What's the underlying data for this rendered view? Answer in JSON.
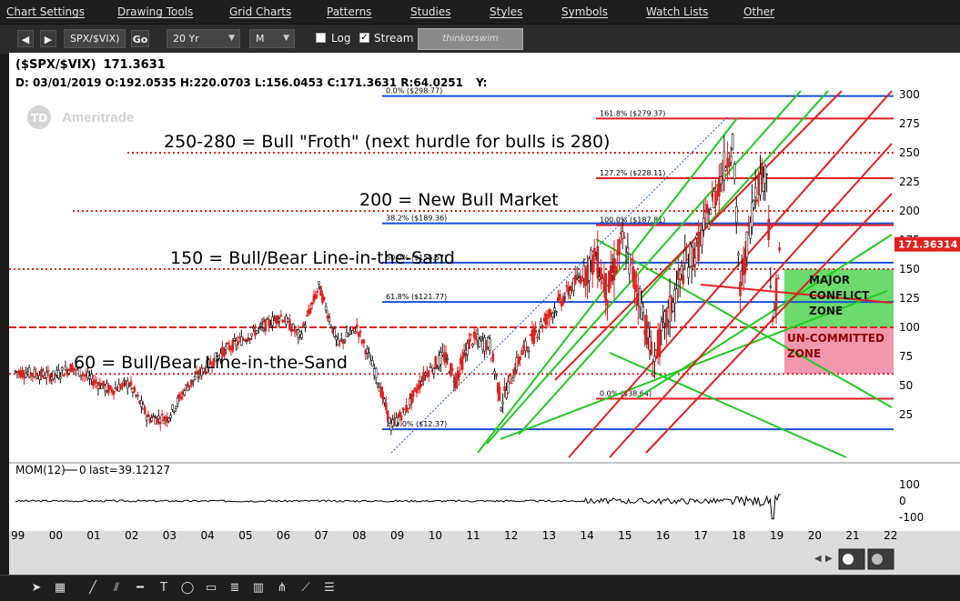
{
  "menu": [
    "Chart Settings",
    "Drawing Tools",
    "Grid Charts",
    "Patterns",
    "Studies",
    "Styles",
    "Symbols",
    "Watch Lists",
    "Other"
  ],
  "toolbar": {
    "symbol": "SPX/$VIX)",
    "go_label": "Go",
    "timeframe": "20 Yr",
    "period": "M",
    "log_label": "Log",
    "log_checked": false,
    "stream_label": "Stream",
    "stream_checked": true,
    "brand_button": "thinkorswim"
  },
  "header": {
    "title_symbol": "($SPX/$VIX)",
    "title_value": "171.3631",
    "ohlc": "D: 03/01/2019 O:192.0535 H:220.0703 L:156.0453 C:171.3631 R:64.0251",
    "y_label": "Y:"
  },
  "watermark": "Ameritrade",
  "watermark_badge": "TD",
  "chart_data": {
    "type": "candlestick",
    "scale": "linear",
    "ylim": [
      0,
      320
    ],
    "y_ticks": [
      25,
      50,
      75,
      100,
      125,
      150,
      175,
      200,
      225,
      250,
      275,
      300
    ],
    "x_ticks": [
      "99",
      "00",
      "01",
      "02",
      "03",
      "04",
      "05",
      "06",
      "07",
      "08",
      "09",
      "10",
      "11",
      "12",
      "13",
      "14",
      "15",
      "16",
      "17",
      "18",
      "19",
      "20",
      "21",
      "22"
    ],
    "last_price": 171.36314,
    "last_price_label": "171.36314",
    "close_path": [
      {
        "x": 1999.0,
        "y": 62
      },
      {
        "x": 2000.0,
        "y": 58
      },
      {
        "x": 2000.5,
        "y": 66
      },
      {
        "x": 2001.0,
        "y": 55
      },
      {
        "x": 2001.5,
        "y": 46
      },
      {
        "x": 2002.0,
        "y": 52
      },
      {
        "x": 2002.5,
        "y": 22
      },
      {
        "x": 2003.0,
        "y": 22
      },
      {
        "x": 2003.5,
        "y": 48
      },
      {
        "x": 2004.0,
        "y": 65
      },
      {
        "x": 2004.5,
        "y": 80
      },
      {
        "x": 2005.0,
        "y": 90
      },
      {
        "x": 2005.5,
        "y": 100
      },
      {
        "x": 2006.0,
        "y": 110
      },
      {
        "x": 2006.5,
        "y": 92
      },
      {
        "x": 2007.0,
        "y": 135
      },
      {
        "x": 2007.5,
        "y": 85
      },
      {
        "x": 2008.0,
        "y": 100
      },
      {
        "x": 2008.5,
        "y": 60
      },
      {
        "x": 2008.9,
        "y": 15
      },
      {
        "x": 2009.3,
        "y": 30
      },
      {
        "x": 2009.8,
        "y": 60
      },
      {
        "x": 2010.3,
        "y": 75
      },
      {
        "x": 2010.6,
        "y": 55
      },
      {
        "x": 2011.0,
        "y": 90
      },
      {
        "x": 2011.5,
        "y": 85
      },
      {
        "x": 2011.8,
        "y": 35
      },
      {
        "x": 2012.3,
        "y": 75
      },
      {
        "x": 2012.8,
        "y": 100
      },
      {
        "x": 2013.3,
        "y": 120
      },
      {
        "x": 2013.8,
        "y": 140
      },
      {
        "x": 2014.3,
        "y": 160
      },
      {
        "x": 2014.6,
        "y": 130
      },
      {
        "x": 2015.0,
        "y": 175
      },
      {
        "x": 2015.5,
        "y": 120
      },
      {
        "x": 2015.8,
        "y": 70
      },
      {
        "x": 2016.2,
        "y": 110
      },
      {
        "x": 2016.6,
        "y": 150
      },
      {
        "x": 2017.0,
        "y": 170
      },
      {
        "x": 2017.5,
        "y": 220
      },
      {
        "x": 2017.9,
        "y": 260
      },
      {
        "x": 2018.1,
        "y": 130
      },
      {
        "x": 2018.5,
        "y": 220
      },
      {
        "x": 2018.8,
        "y": 235
      },
      {
        "x": 2018.95,
        "y": 95
      },
      {
        "x": 2019.1,
        "y": 145
      },
      {
        "x": 2019.17,
        "y": 171
      }
    ],
    "horizontal_levels": [
      {
        "value": 250,
        "label": "250-280 = Bull \"Froth\" (next hurdle for bulls is 280)",
        "color": "#e02020",
        "style": "dotted"
      },
      {
        "value": 200,
        "label": "200 = New Bull Market",
        "color": "#e02020",
        "style": "dotted"
      },
      {
        "value": 150,
        "label": "150 = Bull/Bear Line-in-the-Sand",
        "color": "#e02020",
        "style": "dotted"
      },
      {
        "value": 100,
        "label": "",
        "color": "#e02020",
        "style": "dashed"
      },
      {
        "value": 60,
        "label": "60 = Bull/Bear Line-in-the-Sand",
        "color": "#e02020",
        "style": "dotted"
      }
    ],
    "fib_levels": [
      {
        "value": 298.77,
        "label": "0.0% ($298.77)",
        "color": "#1a4fd6"
      },
      {
        "value": 189.36,
        "label": "38.2% ($189.36)",
        "color": "#1a4fd6"
      },
      {
        "value": 155.57,
        "label": "50.0% ($155.57)",
        "color": "#1a4fd6"
      },
      {
        "value": 121.77,
        "label": "61.8% ($121.77)",
        "color": "#1a4fd6"
      },
      {
        "value": 12.37,
        "label": "100.0% ($12.37)",
        "color": "#1a4fd6"
      },
      {
        "value": 279.37,
        "label": "161.8% ($279.37)",
        "color": "#e02020"
      },
      {
        "value": 228.11,
        "label": "127.2% ($228.11)",
        "color": "#e02020"
      },
      {
        "value": 187.81,
        "label": "100.0% ($187.81)",
        "color": "#e02020"
      },
      {
        "value": 38.64,
        "label": "0.0% ($38.64)",
        "color": "#e02020"
      }
    ],
    "zones": [
      {
        "label_lines": [
          "MAJOR",
          "CONFLICT",
          "ZONE"
        ],
        "y_from": 100,
        "y_to": 150,
        "color": "#5cd65c"
      },
      {
        "label_lines": [
          "UN-COMMITTED",
          "ZONE"
        ],
        "y_from": 60,
        "y_to": 100,
        "color": "#f28ca6"
      }
    ],
    "momentum": {
      "label": "MOM(12)",
      "zero_label": "0",
      "last_label": "last=39.12127",
      "ylim": [
        -130,
        130
      ],
      "y_ticks": [
        "100",
        "0",
        "-100"
      ]
    }
  }
}
